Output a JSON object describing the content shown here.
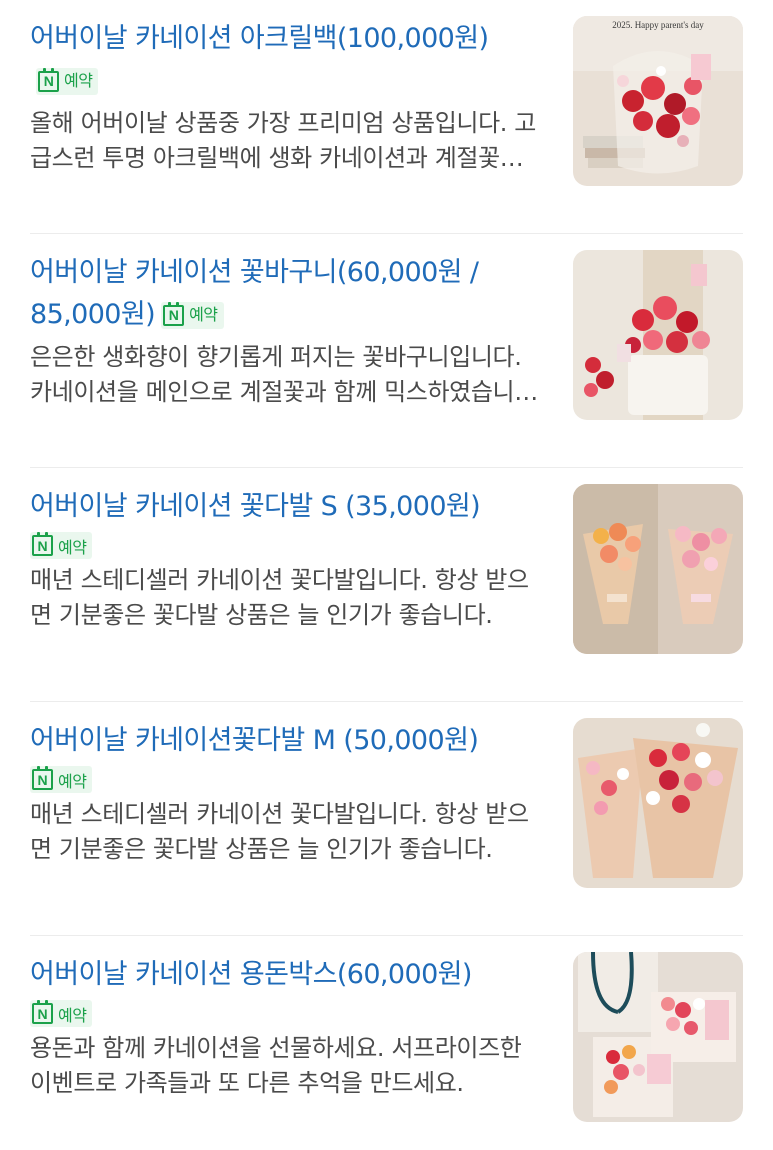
{
  "items": [
    {
      "title": "어버이날 카네이션 아크릴백(100,000원)",
      "badge_label": "예약",
      "description": "올해 어버이날 상품중 가장 프리미엄 상품입니다. 고급스런 투명 아크릴백에 생화 카네이션과 계절꽃을 가득 담았습니다.",
      "image_text": "2025. Happy parent's day"
    },
    {
      "title": "어버이날 카네이션 꽃바구니(60,000원 / 85,000원)",
      "badge_label": "예약",
      "description": "은은한 생화향이 향기롭게 퍼지는 꽃바구니입니다. 카네이션을 메인으로 계절꽃과 함께 믹스하였습니다."
    },
    {
      "title": "어버이날 카네이션 꽃다발 S (35,000원)",
      "badge_label": "예약",
      "description": "매년 스테디셀러 카네이션 꽃다발입니다. 항상 받으면 기분좋은 꽃다발 상품은 늘 인기가 좋습니다."
    },
    {
      "title": "어버이날 카네이션꽃다발 M (50,000원)",
      "badge_label": "예약",
      "description": "매년 스테디셀러 카네이션 꽃다발입니다. 항상 받으면 기분좋은 꽃다발 상품은 늘 인기가 좋습니다."
    },
    {
      "title": "어버이날 카네이션 용돈박스(60,000원)",
      "badge_label": "예약",
      "description": "용돈과 함께 카네이션을 선물하세요. 서프라이즈한 이벤트로 가족들과 또 다른 추억을 만드세요."
    }
  ],
  "badge_icon": "naver-booking-calendar-icon",
  "colors": {
    "title": "#1f6bb8",
    "badge_green": "#1ba14a",
    "badge_bg": "#eaf7ee",
    "description": "#4b4b4b"
  }
}
